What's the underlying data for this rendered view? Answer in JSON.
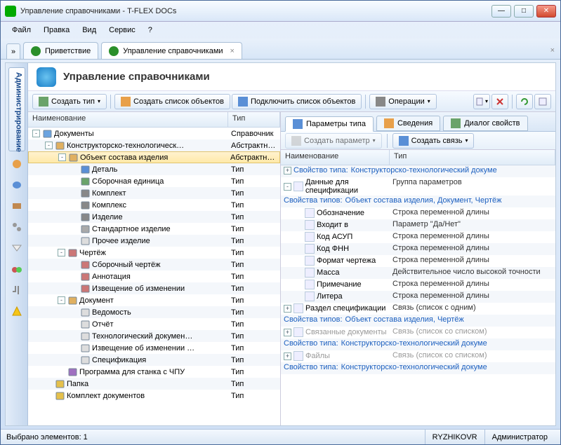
{
  "window_title": "Управление справочниками - T-FLEX DOCs",
  "menubar": [
    "Файл",
    "Правка",
    "Вид",
    "Сервис",
    "?"
  ],
  "doc_tabs": [
    {
      "label": "Приветствие",
      "active": false
    },
    {
      "label": "Управление справочниками",
      "active": true
    }
  ],
  "page_title": "Управление справочниками",
  "sidebar_label": "Администрирование",
  "toolbar": {
    "create_type": "Создать тип",
    "create_list": "Создать список объектов",
    "connect_list": "Подключить список объектов",
    "operations": "Операции"
  },
  "left_grid": {
    "col_name": "Наименование",
    "col_type": "Тип",
    "rows": [
      {
        "d": 0,
        "exp": "-",
        "icon": "#6aa3e0",
        "label": "Документы",
        "type": "Справочник"
      },
      {
        "d": 1,
        "exp": "-",
        "icon": "#e0b060",
        "label": "Конструкторско-технологическ…",
        "type": "Абстрактн…"
      },
      {
        "d": 2,
        "exp": "-",
        "icon": "#e0b060",
        "label": "Объект состава изделия",
        "type": "Абстрактн…",
        "selected": true
      },
      {
        "d": 3,
        "exp": "",
        "icon": "#5a8fd6",
        "label": "Деталь",
        "type": "Тип"
      },
      {
        "d": 3,
        "exp": "",
        "icon": "#6aa36a",
        "label": "Сборочная единица",
        "type": "Тип"
      },
      {
        "d": 3,
        "exp": "",
        "icon": "#888",
        "label": "Комплект",
        "type": "Тип"
      },
      {
        "d": 3,
        "exp": "",
        "icon": "#888",
        "label": "Комплекс",
        "type": "Тип"
      },
      {
        "d": 3,
        "exp": "",
        "icon": "#888",
        "label": "Изделие",
        "type": "Тип"
      },
      {
        "d": 3,
        "exp": "",
        "icon": "#aaa",
        "label": "Стандартное изделие",
        "type": "Тип"
      },
      {
        "d": 3,
        "exp": "",
        "icon": "#ddd",
        "label": "Прочее изделие",
        "type": "Тип"
      },
      {
        "d": 2,
        "exp": "-",
        "icon": "#c77",
        "label": "Чертёж",
        "type": "Тип"
      },
      {
        "d": 3,
        "exp": "",
        "icon": "#c77",
        "label": "Сборочный чертёж",
        "type": "Тип"
      },
      {
        "d": 3,
        "exp": "",
        "icon": "#c77",
        "label": "Аннотация",
        "type": "Тип"
      },
      {
        "d": 3,
        "exp": "",
        "icon": "#c77",
        "label": "Извещение об изменении",
        "type": "Тип"
      },
      {
        "d": 2,
        "exp": "-",
        "icon": "#e0b060",
        "label": "Документ",
        "type": "Тип"
      },
      {
        "d": 3,
        "exp": "",
        "icon": "#ddd",
        "label": "Ведомость",
        "type": "Тип"
      },
      {
        "d": 3,
        "exp": "",
        "icon": "#ddd",
        "label": "Отчёт",
        "type": "Тип"
      },
      {
        "d": 3,
        "exp": "",
        "icon": "#ddd",
        "label": "Технологический докумен…",
        "type": "Тип"
      },
      {
        "d": 3,
        "exp": "",
        "icon": "#ddd",
        "label": "Извещение об изменении …",
        "type": "Тип"
      },
      {
        "d": 3,
        "exp": "",
        "icon": "#ddd",
        "label": "Спецификация",
        "type": "Тип"
      },
      {
        "d": 2,
        "exp": "",
        "icon": "#a070c0",
        "label": "Программа для станка с ЧПУ",
        "type": "Тип"
      },
      {
        "d": 1,
        "exp": "",
        "icon": "#e5c04b",
        "label": "Папка",
        "type": "Тип"
      },
      {
        "d": 1,
        "exp": "",
        "icon": "#e5c04b",
        "label": "Комплект документов",
        "type": "Тип"
      }
    ]
  },
  "right_tabs": [
    {
      "label": "Параметры типа",
      "active": true
    },
    {
      "label": "Сведения",
      "active": false
    },
    {
      "label": "Диалог свойств",
      "active": false
    }
  ],
  "right_toolbar": {
    "create_param": "Создать параметр",
    "create_link": "Создать связь"
  },
  "right_grid": {
    "col_name": "Наименование",
    "col_type": "Тип",
    "rows": [
      {
        "d": 0,
        "exp": "+",
        "kind": "header",
        "label": "Свойство типа:",
        "value": "Конструкторско-технологический докуме",
        "link": true
      },
      {
        "d": 0,
        "exp": "-",
        "kind": "group",
        "label": "Данные для спецификации",
        "value": "Группа параметров"
      },
      {
        "d": 0,
        "exp": "",
        "kind": "sub",
        "label": "Свойства типов:",
        "value": "Объект состава изделия, Документ, Чертёж",
        "link": true
      },
      {
        "d": 1,
        "exp": "",
        "kind": "prop",
        "label": "Обозначение",
        "value": "Строка переменной длины"
      },
      {
        "d": 1,
        "exp": "",
        "kind": "prop",
        "label": "Входит в",
        "value": "Параметр \"Да/Нет\""
      },
      {
        "d": 1,
        "exp": "",
        "kind": "prop",
        "label": "Код АСУП",
        "value": "Строка переменной длины"
      },
      {
        "d": 1,
        "exp": "",
        "kind": "prop",
        "label": "Код ФНН",
        "value": "Строка переменной длины"
      },
      {
        "d": 1,
        "exp": "",
        "kind": "prop",
        "label": "Формат чертежа",
        "value": "Строка переменной длины"
      },
      {
        "d": 1,
        "exp": "",
        "kind": "prop",
        "label": "Масса",
        "value": "Действительное число высокой точности"
      },
      {
        "d": 1,
        "exp": "",
        "kind": "prop",
        "label": "Примечание",
        "value": "Строка переменной длины"
      },
      {
        "d": 1,
        "exp": "",
        "kind": "prop",
        "label": "Литера",
        "value": "Строка переменной длины"
      },
      {
        "d": 0,
        "exp": "+",
        "kind": "prop",
        "label": "Раздел спецификации",
        "value": "Связь (список с одним)"
      },
      {
        "d": 0,
        "exp": "",
        "kind": "sub",
        "label": "Свойства типов:",
        "value": "Объект состава изделия, Чертёж",
        "link": true
      },
      {
        "d": 0,
        "exp": "+",
        "kind": "dis",
        "label": "Связанные документы",
        "value": "Связь (список со списком)"
      },
      {
        "d": 0,
        "exp": "",
        "kind": "header",
        "label": "Свойство типа:",
        "value": "Конструкторско-технологический докуме",
        "link": true
      },
      {
        "d": 0,
        "exp": "+",
        "kind": "dis",
        "label": "Файлы",
        "value": "Связь (список со списком)"
      },
      {
        "d": 0,
        "exp": "",
        "kind": "header",
        "label": "Свойство типа:",
        "value": "Конструкторско-технологический докуме",
        "link": true
      }
    ]
  },
  "statusbar": {
    "selection": "Выбрано элементов: 1",
    "user": "RYZHIKOVR",
    "role": "Администратор"
  }
}
